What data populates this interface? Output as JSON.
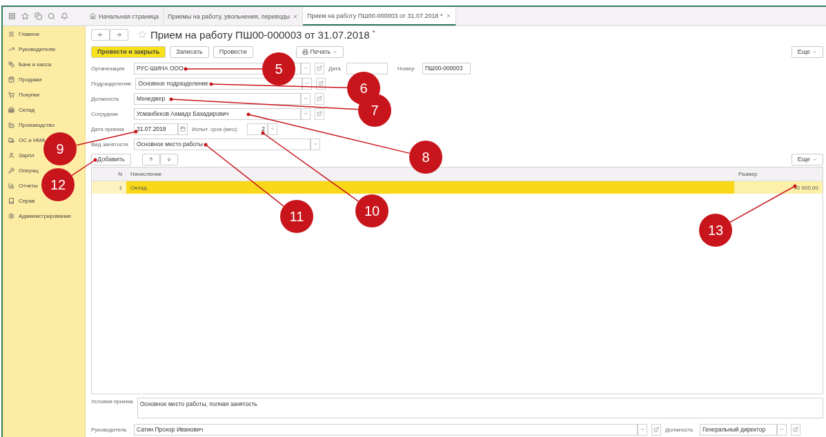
{
  "topbar": {
    "tabs": [
      {
        "label": "Начальная страница",
        "kind": "home",
        "selected": false
      },
      {
        "label": "Приемы на работу, увольнения, переводы",
        "kind": "closable",
        "selected": false
      },
      {
        "label": "Прием на работу ПШ00-000003 от 31.07.2018 *",
        "kind": "closable",
        "selected": true
      }
    ]
  },
  "sidebar": {
    "items": [
      {
        "label": "Главное"
      },
      {
        "label": "Руководителю"
      },
      {
        "label": "Банк и касса"
      },
      {
        "label": "Продажи"
      },
      {
        "label": "Покупки"
      },
      {
        "label": "Склад"
      },
      {
        "label": "Производство"
      },
      {
        "label": "ОС и НМА"
      },
      {
        "label": "Зарпл"
      },
      {
        "label": "Операц"
      },
      {
        "label": "Отчеты"
      },
      {
        "label": "Справ"
      },
      {
        "label": "Администрирование"
      }
    ]
  },
  "document": {
    "title": "Прием на работу ПШ00-000003 от 31.07.2018",
    "modified_mark": "*",
    "toolbar": [
      {
        "label": "Провести и закрыть",
        "kind": "primary"
      },
      {
        "label": "Записать",
        "kind": "plain"
      },
      {
        "label": "Провести",
        "kind": "plain"
      },
      {
        "label": "Печать",
        "kind": "menu"
      }
    ],
    "more_button": "Еще",
    "organization": {
      "label": "Организация",
      "value": "РУС-ШИНА ООО"
    },
    "date": {
      "label": "Дата"
    },
    "number": {
      "label": "Номер",
      "value": "ПШ00-000003"
    },
    "department": {
      "label": "Подразделение",
      "value": "Основное подразделение"
    },
    "position": {
      "label": "Должность",
      "value": "Менеджер"
    },
    "employee": {
      "label": "Сотрудник",
      "value": "Усманбеков Ахмадх Бахадирович"
    },
    "hire_date": {
      "label": "Дата приема",
      "value": "31.07.2018"
    },
    "probation": {
      "label": "Испыт. срок (мес):",
      "value": "2"
    },
    "employment_type": {
      "label": "Вид занятости",
      "value": "Основное место работы"
    },
    "table": {
      "add_button": "Добавить",
      "more_button": "Еще",
      "columns": [
        "N",
        "Начисление",
        "Размер"
      ],
      "rows": [
        {
          "n": "1",
          "accrual": "Оклад",
          "amount": "40 000,00",
          "selected": true
        }
      ]
    },
    "conditions": {
      "label": "Условия приема",
      "value": "Основное место работы, полная занятость"
    },
    "manager": {
      "label": "Руководитель",
      "value": "Сатин Прохор Иванович"
    },
    "manager_position": {
      "label": "Должность",
      "value": "Генеральный директор"
    }
  },
  "callouts": [
    {
      "number": "5"
    },
    {
      "number": "6"
    },
    {
      "number": "7"
    },
    {
      "number": "8"
    },
    {
      "number": "9"
    },
    {
      "number": "10"
    },
    {
      "number": "11"
    },
    {
      "number": "12"
    },
    {
      "number": "13"
    }
  ]
}
